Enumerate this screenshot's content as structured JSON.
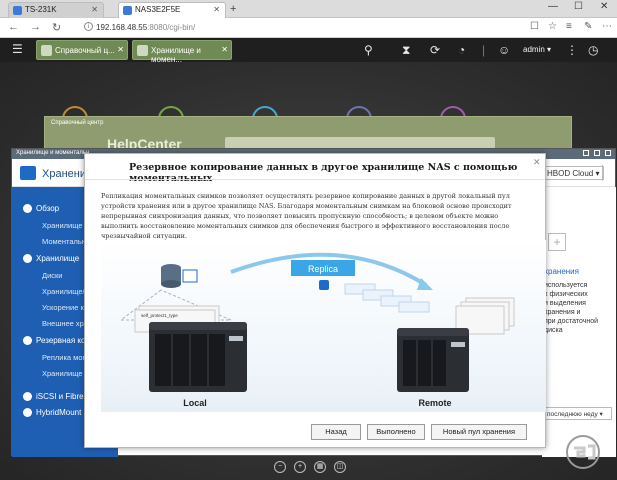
{
  "browser": {
    "tabs": [
      {
        "label": "TS-231K"
      },
      {
        "label": "NAS3E2F5E"
      }
    ],
    "url_host": "192.168.48.55",
    "url_path": ":8080/cgi-bin/"
  },
  "qts": {
    "tabs": [
      {
        "label": "Справочный ц..."
      },
      {
        "label": "Хранилище и момен..."
      }
    ],
    "user": "admin ▾"
  },
  "help_center": {
    "window_title": "Справочный центр",
    "brand": "HelpCenter"
  },
  "storage_window": {
    "window_title": "Хранилище и моментальн...",
    "app_title": "Хранение и",
    "cloud_button": "HBOD Cloud ▾",
    "sidebar": [
      {
        "label": "Обзор",
        "type": "section"
      },
      {
        "label": "Хранилище",
        "type": "sub"
      },
      {
        "label": "Моментальн...",
        "type": "sub"
      },
      {
        "label": "Хранилище",
        "type": "section"
      },
      {
        "label": "Диски",
        "type": "sub"
      },
      {
        "label": "Хранилище/М...",
        "type": "sub"
      },
      {
        "label": "Ускорение ке...",
        "type": "sub"
      },
      {
        "label": "Внешнее хран...",
        "type": "sub"
      },
      {
        "label": "Резервная ко...",
        "type": "section"
      },
      {
        "label": "Реплика моме...",
        "type": "sub"
      },
      {
        "label": "Хранилище м...",
        "type": "sub"
      },
      {
        "label": "iSCSI и Fibre C...",
        "type": "section"
      },
      {
        "label": "HybridMount",
        "type": "section"
      }
    ],
    "right_pane": {
      "heading": "хранения",
      "lines": [
        "используется",
        "х физических",
        "и выделения",
        "хранения и",
        "при достаточной",
        "диска"
      ],
      "select": "последнюю неду ▾"
    }
  },
  "dialog": {
    "title": "Резервное копирование данных в другое хранилище NAS с помощью моментальных",
    "description": "Репликация моментальных снимков позволяет осуществлять резервное копирование данных в другой локальный пул устройств хранения или в другое хранилище NAS. Благодаря моментальным снимкам на блоковой основе происходит непрерывная синхронизация данных, что позволяет повысить пропускную способность; в целевом объекте можно выполнить восстановление моментальных снимков для обеспечения быстрого и эффективного восстановления после чрезвычайной ситуации.",
    "illustration": {
      "replica_label": "Replica",
      "local_label": "Local",
      "remote_label": "Remote",
      "pool_label": "self_protect1_type"
    },
    "buttons": {
      "back": "Назад",
      "done": "Выполнено",
      "new_pool": "Новый пул хранения"
    }
  },
  "colors": {
    "sidebar": "#1f5fb3",
    "replica_box": "#3aa6e6",
    "qts_tab": "#6f8a55"
  }
}
